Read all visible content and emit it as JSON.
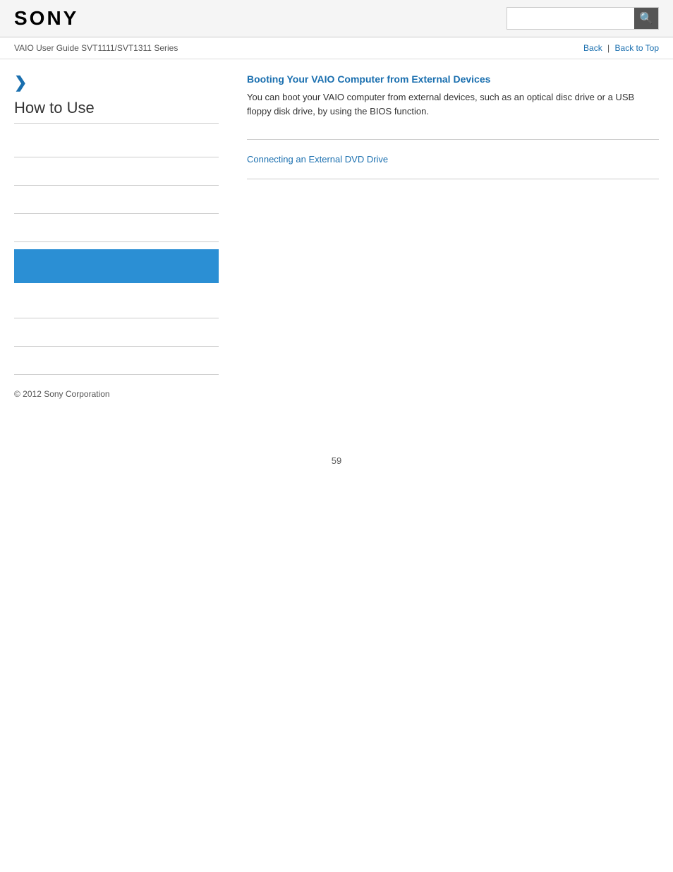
{
  "header": {
    "logo": "SONY",
    "search_placeholder": "",
    "search_icon": "🔍"
  },
  "sub_header": {
    "guide_title": "VAIO User Guide SVT1111/SVT1311 Series",
    "nav": {
      "back_label": "Back",
      "separator": "|",
      "back_to_top_label": "Back to Top"
    }
  },
  "sidebar": {
    "chevron": "❯",
    "title": "How to Use",
    "items": [
      {
        "label": ""
      },
      {
        "label": ""
      },
      {
        "label": ""
      },
      {
        "label": ""
      }
    ],
    "highlight": {
      "label": ""
    },
    "footer_items": [
      {
        "label": ""
      },
      {
        "label": ""
      },
      {
        "label": ""
      }
    ],
    "copyright": "© 2012 Sony Corporation"
  },
  "content": {
    "sections": [
      {
        "link_text": "Booting Your VAIO Computer from External Devices",
        "description": "You can boot your VAIO computer from external devices, such as an optical disc drive or a USB floppy disk drive, by using the BIOS function."
      }
    ],
    "simple_links": [
      {
        "link_text": "Connecting an External DVD Drive"
      }
    ]
  },
  "page_number": "59"
}
